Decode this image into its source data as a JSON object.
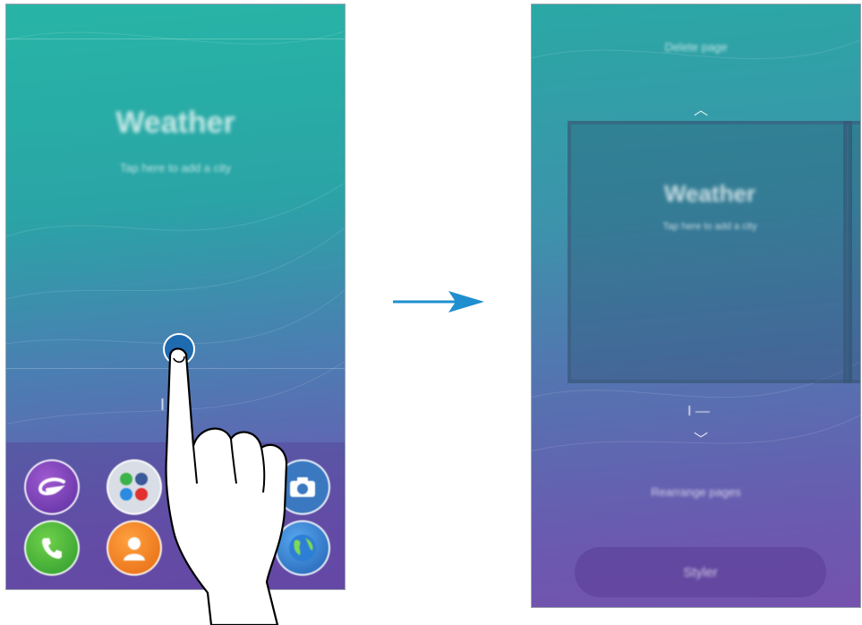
{
  "left_screen": {
    "weather_title": "Weather",
    "weather_subtitle": "Tap here to add a city",
    "page_indicator": "I",
    "dock_apps": [
      {
        "icon": "galaxy-apps-icon"
      },
      {
        "icon": "social-folder-icon"
      },
      {
        "icon": "camera-icon"
      },
      {
        "icon": "phone-icon"
      },
      {
        "icon": "contacts-icon"
      },
      {
        "icon": "internet-icon"
      }
    ]
  },
  "right_screen": {
    "delete_page": "Delete page",
    "weather_title": "Weather",
    "weather_subtitle": "Tap here to add a city",
    "page_indicator": "I —",
    "rearrange_pages": "Rearrange pages",
    "styler_label": "Styler"
  },
  "colors": {
    "arrow": "#1f8fcf",
    "touch_point": "#1f6bb0"
  }
}
